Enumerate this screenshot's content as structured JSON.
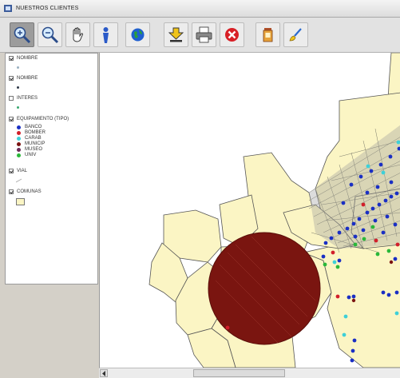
{
  "window": {
    "title": "NUESTROS CLIENTES",
    "icon": "app-icon"
  },
  "toolbar": {
    "buttons": [
      {
        "name": "zoom-in-button",
        "icon": "zoom-in-icon",
        "active": true
      },
      {
        "name": "zoom-out-button",
        "icon": "zoom-out-icon",
        "active": false
      },
      {
        "name": "pan-button",
        "icon": "hand-icon",
        "active": false
      },
      {
        "name": "identify-button",
        "icon": "person-icon",
        "active": false
      },
      {
        "name": "full-extent-button",
        "icon": "globe-icon",
        "active": false
      },
      {
        "name": "add-layer-button",
        "icon": "add-layer-icon",
        "active": false
      },
      {
        "name": "print-button",
        "icon": "printer-icon",
        "active": false
      },
      {
        "name": "delete-button",
        "icon": "close-icon",
        "active": false
      },
      {
        "name": "query-button",
        "icon": "jar-icon",
        "active": false
      },
      {
        "name": "clear-button",
        "icon": "brush-icon",
        "active": false
      }
    ]
  },
  "legend": {
    "layers": [
      {
        "label": "NOMBRE",
        "checked": true,
        "symbol": "point",
        "color": "#9ab0c0"
      },
      {
        "label": "NOMBRE",
        "checked": true,
        "symbol": "point",
        "color": "#303848"
      },
      {
        "label": "INTERES",
        "checked": false,
        "symbol": "point",
        "color": "#3aa870"
      },
      {
        "label": "EQUIPAMIENTO (TIPO)",
        "checked": true,
        "symbol": "categories"
      },
      {
        "label": "VIAL",
        "checked": true,
        "symbol": "line",
        "color": "#b0b0b0"
      },
      {
        "label": "COMUNAS",
        "checked": true,
        "symbol": "polygon",
        "color": "#fbf5c4"
      }
    ],
    "categories": [
      {
        "label": "BANCO",
        "color": "#1a2fc4"
      },
      {
        "label": "BOMBER",
        "color": "#d21f2a"
      },
      {
        "label": "CARAB",
        "color": "#3ed0d8"
      },
      {
        "label": "MUNICIP",
        "color": "#7b1412"
      },
      {
        "label": "MUSEO",
        "color": "#6a2a5a"
      },
      {
        "label": "UNIV",
        "color": "#2ab83a"
      }
    ]
  },
  "map": {
    "colors": {
      "comunas": "#fbf5c4",
      "border": "#555555",
      "selection": "#7a1510",
      "banco": "#1a2fc4",
      "bomber": "#d21f2a",
      "carab": "#3ed0d8",
      "univ": "#2ab83a"
    }
  }
}
